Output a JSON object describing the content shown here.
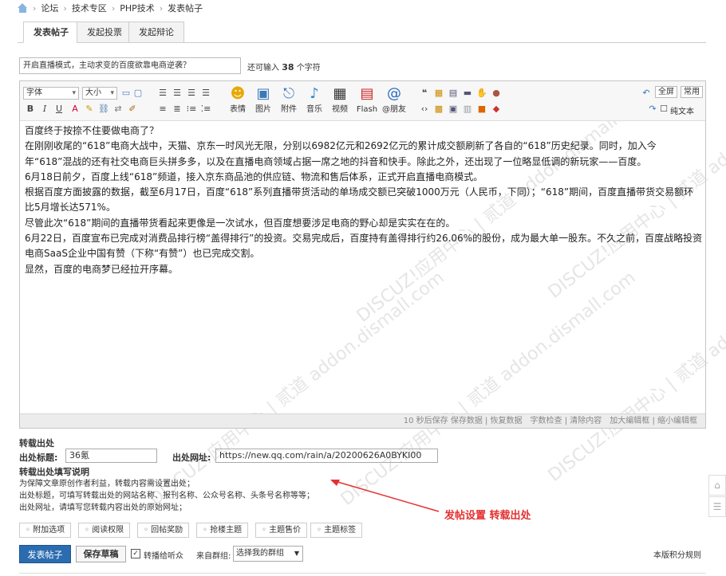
{
  "breadcrumb": [
    "论坛",
    "技术专区",
    "PHP技术",
    "发表帖子"
  ],
  "tabs": [
    "发表帖子",
    "发起投票",
    "发起辩论"
  ],
  "title_input": {
    "value": "开启直播模式，主动求变的百度欲靠电商逆袭？"
  },
  "char_count": {
    "prefix": "还可输入",
    "count": "38",
    "suffix": "个字符"
  },
  "toolbar": {
    "font_select": "字体",
    "size_select": "大小",
    "big_buttons": [
      "表情",
      "图片",
      "附件",
      "音乐",
      "视频",
      "Flash",
      "@朋友"
    ],
    "fullscreen": "全屏",
    "common": "常用",
    "plain_text": "纯文本"
  },
  "content": [
    "百度终于按捺不住要做电商了？",
    "在刚刚收尾的“618”电商大战中，天猫、京东一时风光无限，分别以6982亿元和2692亿元的累计成交额刷新了各自的“618”历史纪录。同时，加入今年“618”混战的还有社交电商巨头拼多多，以及在直播电商领域占据一席之地的抖音和快手。除此之外，还出现了一位略显低调的新玩家——百度。",
    "6月18日前夕，百度上线“618”频道，接入京东商品池的供应链、物流和售后体系，正式开启直播电商模式。",
    "根据百度方面披露的数据，截至6月17日，百度“618”系列直播带货活动的单场成交额已突破1000万元（人民币，下同）；“618”期间，百度直播带货交易额环比5月增长达571%。",
    "尽管此次“618”期间的直播带货看起来更像是一次试水，但百度想要涉足电商的野心却是实实在在的。",
    "6月22日，百度宣布已完成对消费品排行榜“盖得排行”的投资。交易完成后，百度持有盖得排行约26.06%的股份，成为最大单一股东。不久之前，百度战略投资电商SaaS企业中国有赞（下称“有赞”）也已完成交割。",
    "显然，百度的电商梦已经拉开序幕。"
  ],
  "status_bar": "10 秒后保存 保存数据 | 恢复数据　字数检查 | 清除内容　加大编辑框 | 缩小编辑框",
  "source": {
    "heading": "转载出处",
    "title_label": "出处标题:",
    "title_value": "36氪",
    "url_label": "出处网址:",
    "url_value": "https://new.qq.com/rain/a/20200626A0BYKI00",
    "help_heading": "转载出处填写说明",
    "help_lines": [
      "为保障文章原创作者利益，转载内容需设置出处；",
      "出处标题，可填写转载出处的网站名称、报刊名称、公众号名称、头条号名称等等；",
      "出处网址，请填写您转载内容出处的原始网址；"
    ]
  },
  "annotation": "发帖设置 转载出处",
  "options": [
    "附加选项",
    "阅读权限",
    "回帖奖励",
    "抢楼主题",
    "主题售价",
    "主题标签"
  ],
  "actions": {
    "submit": "发表帖子",
    "save_draft": "保存草稿",
    "notify_label": "转播给听众",
    "group_label": "来自群组:",
    "group_select": "选择我的群组",
    "rules_link": "本版积分规则"
  },
  "watermark": "DISCUZ!应用中心 | 贰道 addon.dismall.com",
  "colors": {
    "accent": "#2b6cb0",
    "annotation": "#e53030"
  }
}
